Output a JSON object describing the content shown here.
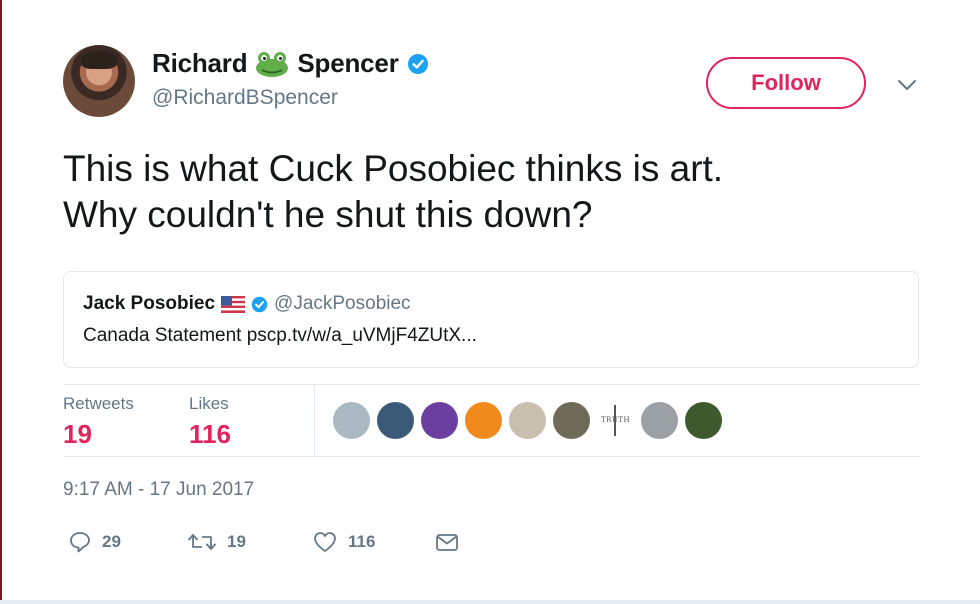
{
  "author": {
    "first_name": "Richard",
    "last_name": "Spencer",
    "handle": "@RichardBSpencer"
  },
  "follow_label": "Follow",
  "tweet": {
    "lines": [
      "This is what Cuck Posobiec thinks is art.",
      "Why couldn't he shut this down?"
    ]
  },
  "quoted": {
    "name": "Jack Posobiec",
    "handle": "@JackPosobiec",
    "text": "Canada Statement pscp.tv/w/a_uVMjF4ZUtX..."
  },
  "stats": {
    "retweets_label": "Retweets",
    "retweets_value": "19",
    "likes_label": "Likes",
    "likes_value": "116"
  },
  "liker_avatars": [
    {
      "name": "default-avatar",
      "color": "#aab8c2"
    },
    {
      "name": "gaming-avatar",
      "color": "#3a5a78"
    },
    {
      "name": "purple-avatar",
      "color": "#6a3fa0"
    },
    {
      "name": "orange-avatar",
      "color": "#f08a1c"
    },
    {
      "name": "photo-avatar",
      "color": "#c9bfae"
    },
    {
      "name": "group-avatar",
      "color": "#6d6b58"
    },
    {
      "name": "truth-avatar",
      "color": "#ffffff",
      "text": "TRUTH"
    },
    {
      "name": "grey-avatar",
      "color": "#9aa0a3"
    },
    {
      "name": "outdoor-avatar",
      "color": "#3e5a2c"
    }
  ],
  "timestamp": "9:17 AM - 17 Jun 2017",
  "actions": {
    "replies": "29",
    "retweets": "19",
    "likes": "116"
  },
  "colors": {
    "accent_red": "#e0245e",
    "verified_blue": "#1da1f2",
    "muted_gray": "#657786"
  },
  "icons": [
    "frog-icon",
    "verified-badge-icon",
    "chevron-down-icon",
    "us-flag-icon",
    "reply-icon",
    "retweet-icon",
    "heart-icon",
    "mail-icon"
  ]
}
